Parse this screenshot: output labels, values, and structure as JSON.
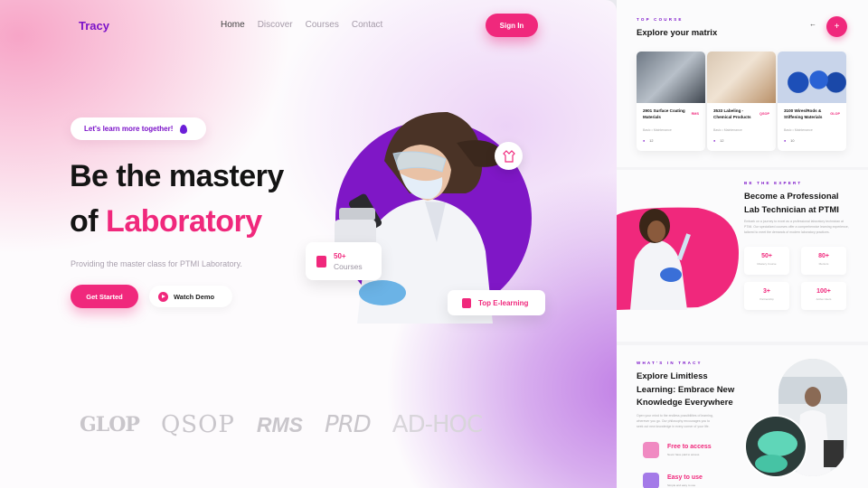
{
  "header": {
    "logo": "Tracy",
    "nav": [
      "Home",
      "Discover",
      "Courses",
      "Contact"
    ],
    "signin_label": "Sign In"
  },
  "hero": {
    "pill_text": "Let's learn more together!",
    "headline_line1": "Be the mastery",
    "headline_of": "of",
    "headline_accent": "Laboratory",
    "description": "Providing the master class for PTMI Laboratory.",
    "get_started_label": "Get Started",
    "watch_demo_label": "Watch Demo",
    "courses_count": "50+",
    "courses_label": "Courses",
    "elearning_label": "Top E-learning"
  },
  "brands": [
    "GLOP",
    "QSOP",
    "RMS",
    "PRD",
    "AD-HOC"
  ],
  "top_course": {
    "kicker": "TOP COURSE",
    "title": "Explore your matrix",
    "cards": [
      {
        "title": "2901 Surface Coating Materials",
        "tag": "RMS",
        "sub": "Basic • Maintenance",
        "users": "12"
      },
      {
        "title": "3533 Labeling - Chemical Products",
        "tag": "QSOP",
        "sub": "Basic • Maintenance",
        "users": "12"
      },
      {
        "title": "3100 Wires/Rods & Stiffening Materials",
        "tag": "GLOP",
        "sub": "Basic • Maintenance",
        "users": "10"
      }
    ]
  },
  "expert": {
    "kicker": "BE THE EXPERT",
    "title_line1": "Become a Professional",
    "title_line2": "Lab Technician at PTMI",
    "description": "Embark on a journey to excel as a professional laboratory technician at PTMI. Our specialized courses offer a comprehensive learning experience, tailored to meet the demands of modern laboratory practices.",
    "stats": [
      {
        "value": "50+",
        "label": "Mastery Course"
      },
      {
        "value": "80+",
        "label": "Mentors"
      },
      {
        "value": "3+",
        "label": "Partnership"
      },
      {
        "value": "100+",
        "label": "Active Users"
      }
    ]
  },
  "whats_in": {
    "kicker": "WHAT'S IN TRACY",
    "title_line1": "Explore Limitless",
    "title_line2": "Learning: Embrace New",
    "title_line3": "Knowledge Everywhere",
    "description": "Open your mind to the endless possibilities of learning, wherever you go. Our philosophy encourages you to seek out new knowledge in every corner of your life.",
    "features": [
      {
        "title": "Free to access",
        "sub": "Never have paid to access"
      },
      {
        "title": "Easy to use",
        "sub": "Simple and easy to use"
      }
    ]
  },
  "colors": {
    "accent": "#f0287c",
    "brand": "#7b12c9"
  }
}
